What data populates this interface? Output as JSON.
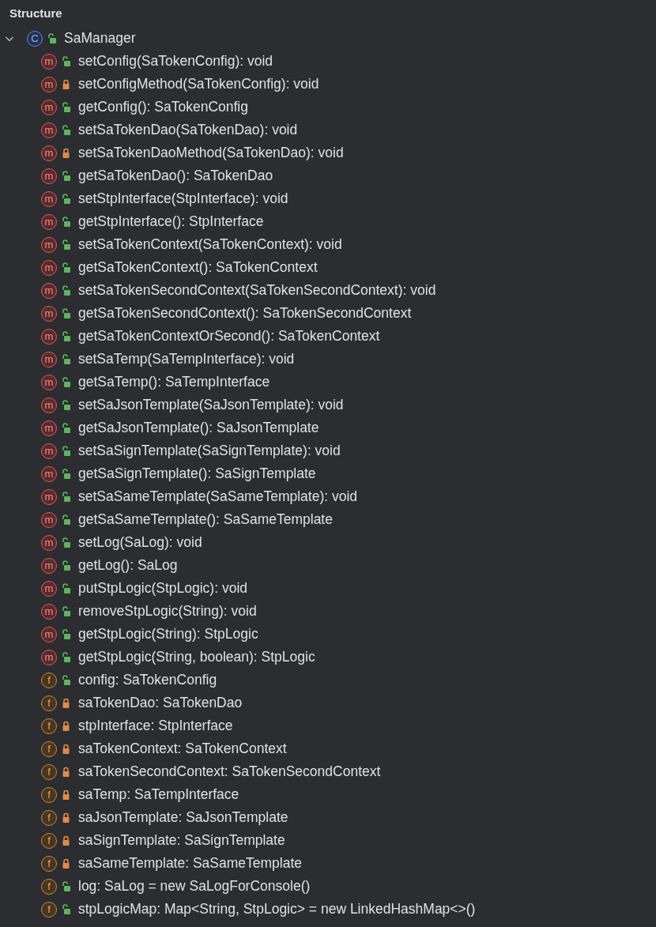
{
  "panel": {
    "title": "Structure"
  },
  "root": {
    "name": "SaManager",
    "kind": "class",
    "badge": "C",
    "locked": false,
    "expanded": true,
    "children": [
      {
        "kind": "method",
        "badge": "m",
        "locked": false,
        "label": "setConfig(SaTokenConfig): void"
      },
      {
        "kind": "method",
        "badge": "m",
        "locked": true,
        "label": "setConfigMethod(SaTokenConfig): void"
      },
      {
        "kind": "method",
        "badge": "m",
        "locked": false,
        "label": "getConfig(): SaTokenConfig"
      },
      {
        "kind": "method",
        "badge": "m",
        "locked": false,
        "label": "setSaTokenDao(SaTokenDao): void"
      },
      {
        "kind": "method",
        "badge": "m",
        "locked": true,
        "label": "setSaTokenDaoMethod(SaTokenDao): void"
      },
      {
        "kind": "method",
        "badge": "m",
        "locked": false,
        "label": "getSaTokenDao(): SaTokenDao"
      },
      {
        "kind": "method",
        "badge": "m",
        "locked": false,
        "label": "setStpInterface(StpInterface): void"
      },
      {
        "kind": "method",
        "badge": "m",
        "locked": false,
        "label": "getStpInterface(): StpInterface"
      },
      {
        "kind": "method",
        "badge": "m",
        "locked": false,
        "label": "setSaTokenContext(SaTokenContext): void"
      },
      {
        "kind": "method",
        "badge": "m",
        "locked": false,
        "label": "getSaTokenContext(): SaTokenContext"
      },
      {
        "kind": "method",
        "badge": "m",
        "locked": false,
        "label": "setSaTokenSecondContext(SaTokenSecondContext): void"
      },
      {
        "kind": "method",
        "badge": "m",
        "locked": false,
        "label": "getSaTokenSecondContext(): SaTokenSecondContext"
      },
      {
        "kind": "method",
        "badge": "m",
        "locked": false,
        "label": "getSaTokenContextOrSecond(): SaTokenContext"
      },
      {
        "kind": "method",
        "badge": "m",
        "locked": false,
        "label": "setSaTemp(SaTempInterface): void"
      },
      {
        "kind": "method",
        "badge": "m",
        "locked": false,
        "label": "getSaTemp(): SaTempInterface"
      },
      {
        "kind": "method",
        "badge": "m",
        "locked": false,
        "label": "setSaJsonTemplate(SaJsonTemplate): void"
      },
      {
        "kind": "method",
        "badge": "m",
        "locked": false,
        "label": "getSaJsonTemplate(): SaJsonTemplate"
      },
      {
        "kind": "method",
        "badge": "m",
        "locked": false,
        "label": "setSaSignTemplate(SaSignTemplate): void"
      },
      {
        "kind": "method",
        "badge": "m",
        "locked": false,
        "label": "getSaSignTemplate(): SaSignTemplate"
      },
      {
        "kind": "method",
        "badge": "m",
        "locked": false,
        "label": "setSaSameTemplate(SaSameTemplate): void"
      },
      {
        "kind": "method",
        "badge": "m",
        "locked": false,
        "label": "getSaSameTemplate(): SaSameTemplate"
      },
      {
        "kind": "method",
        "badge": "m",
        "locked": false,
        "label": "setLog(SaLog): void"
      },
      {
        "kind": "method",
        "badge": "m",
        "locked": false,
        "label": "getLog(): SaLog"
      },
      {
        "kind": "method",
        "badge": "m",
        "locked": false,
        "label": "putStpLogic(StpLogic): void"
      },
      {
        "kind": "method",
        "badge": "m",
        "locked": false,
        "label": "removeStpLogic(String): void"
      },
      {
        "kind": "method",
        "badge": "m",
        "locked": false,
        "label": "getStpLogic(String): StpLogic"
      },
      {
        "kind": "method",
        "badge": "m",
        "locked": false,
        "label": "getStpLogic(String, boolean): StpLogic"
      },
      {
        "kind": "field",
        "badge": "f",
        "locked": false,
        "label": "config: SaTokenConfig"
      },
      {
        "kind": "field",
        "badge": "f",
        "locked": true,
        "label": "saTokenDao: SaTokenDao"
      },
      {
        "kind": "field",
        "badge": "f",
        "locked": true,
        "label": "stpInterface: StpInterface"
      },
      {
        "kind": "field",
        "badge": "f",
        "locked": true,
        "label": "saTokenContext: SaTokenContext"
      },
      {
        "kind": "field",
        "badge": "f",
        "locked": true,
        "label": "saTokenSecondContext: SaTokenSecondContext"
      },
      {
        "kind": "field",
        "badge": "f",
        "locked": true,
        "label": "saTemp: SaTempInterface"
      },
      {
        "kind": "field",
        "badge": "f",
        "locked": true,
        "label": "saJsonTemplate: SaJsonTemplate"
      },
      {
        "kind": "field",
        "badge": "f",
        "locked": true,
        "label": "saSignTemplate: SaSignTemplate"
      },
      {
        "kind": "field",
        "badge": "f",
        "locked": true,
        "label": "saSameTemplate: SaSameTemplate"
      },
      {
        "kind": "field",
        "badge": "f",
        "locked": false,
        "label": "log: SaLog = new SaLogForConsole()"
      },
      {
        "kind": "field",
        "badge": "f",
        "locked": false,
        "label": "stpLogicMap: Map<String, StpLogic> = new LinkedHashMap<>()"
      }
    ]
  }
}
